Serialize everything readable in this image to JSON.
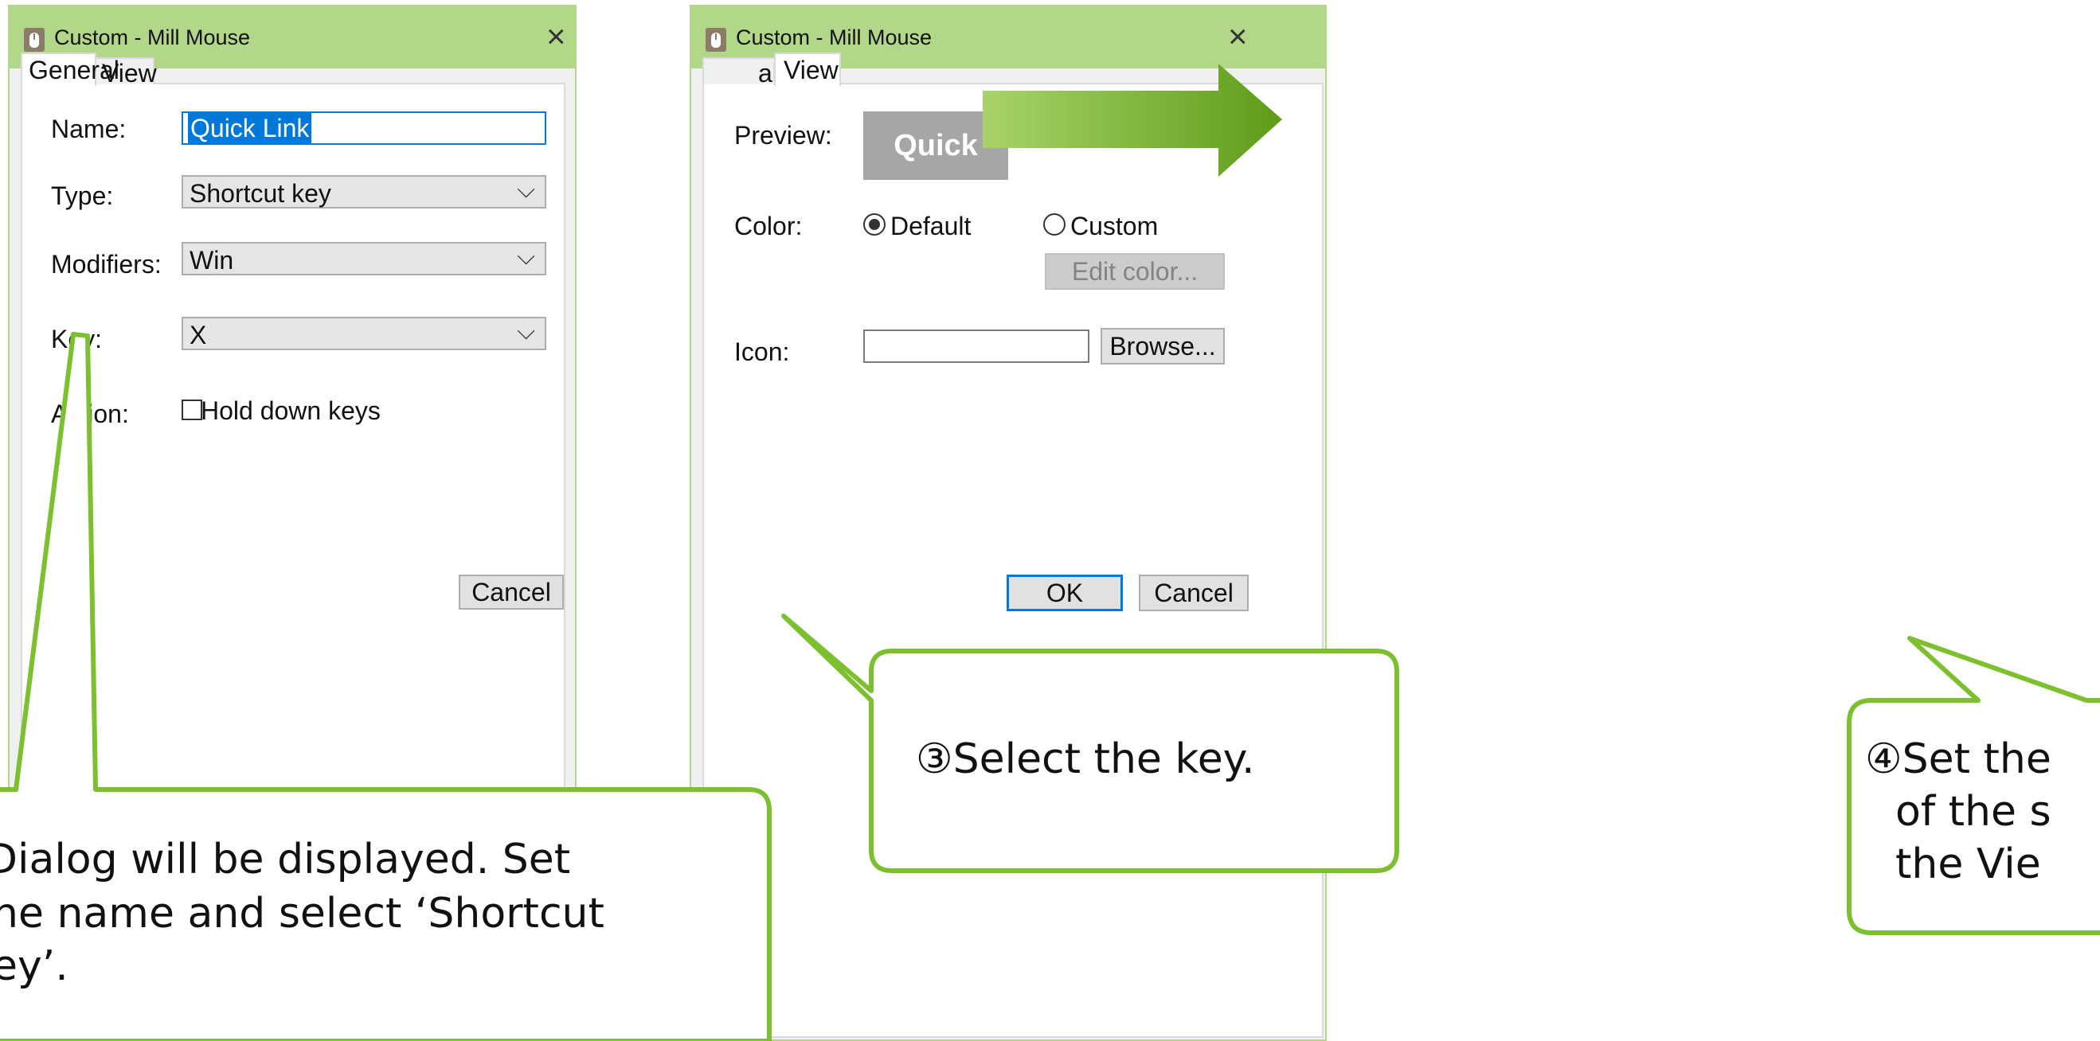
{
  "dialogs": {
    "left": {
      "title": "Custom - Mill Mouse",
      "close_glyph": "×",
      "tabs": [
        "General",
        "View"
      ],
      "fields": {
        "name_label": "Name:",
        "name_value": "Quick Link",
        "type_label": "Type:",
        "type_value": "Shortcut key",
        "modifiers_label": "Modifiers:",
        "modifiers_value": "Win",
        "key_label": "Key:",
        "key_value": "X",
        "action_label": "Action:",
        "hold_down_label": "Hold down keys"
      },
      "cancel_label": "Cancel"
    },
    "right": {
      "title": "Custom - Mill Mouse",
      "close_glyph": "×",
      "tabs": [
        "al",
        "View"
      ],
      "fields": {
        "preview_label": "Preview:",
        "preview_text": "Quick Link",
        "color_label": "Color:",
        "default_label": "Default",
        "custom_label": "Custom",
        "edit_color_label": "Edit color...",
        "icon_label": "Icon:",
        "icon_value": "",
        "browse_label": "Browse..."
      },
      "ok_label": "OK",
      "cancel_label": "Cancel"
    }
  },
  "callouts": {
    "left": [
      "Dialog will be displayed. Set",
      "he name and select ‘Shortcut",
      "ey’."
    ],
    "middle": "③Select the key.",
    "right": [
      "④Set the",
      "of the s",
      "the Vie"
    ]
  },
  "chevron_glyph": "⌵",
  "colors": {
    "titlebar": "#b3d789",
    "callout_border": "#7cbf2f",
    "arrow": "#6fae22",
    "selection": "#0078d7",
    "preview_bg": "#a6a6a6"
  },
  "icons": [
    "mouse-app-icon",
    "close-icon",
    "chevron-down-icon",
    "checkbox-icon",
    "radio-icon",
    "arrow-right-icon"
  ]
}
